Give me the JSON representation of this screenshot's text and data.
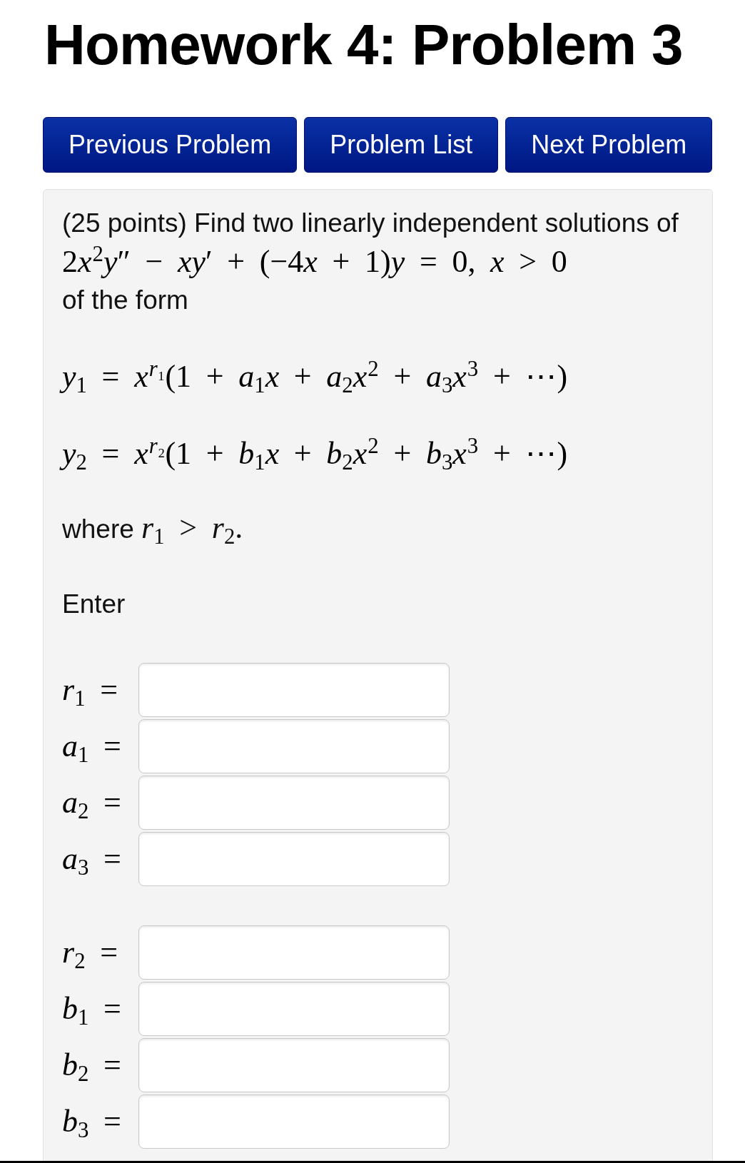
{
  "title": "Homework 4: Problem 3",
  "nav_buttons": [
    {
      "label": "Previous Problem"
    },
    {
      "label": "Problem List"
    },
    {
      "label": "Next Problem"
    }
  ],
  "problem": {
    "intro": "(25 points) Find two linearly independent solutions of",
    "equation": "2x$^{2}$y″ − xy′ + (−4x + 1)y = 0, x > 0",
    "form_text": "of the form",
    "solutions": [
      "y$_{1}$ = x$^{r₁}$(1 + a$_{1}$x + a$_{2}$x$^{2}$ + a$_{3}$x$^{3}$ + ⋯)",
      "y$_{2}$ = x$^{r₂}$(1 + b$_{1}$x + b$_{2}$x$^{2}$ + b$_{3}$x$^{3}$ + ⋯)"
    ],
    "condition": {
      "text": "where",
      "math": "r$_{1}$ > r$_{2}$."
    },
    "prompt": "Enter",
    "answer_groups": [
      {
        "fields": [
          {
            "label": "r$_{1}$ ="
          },
          {
            "label": "a$_{1}$ ="
          },
          {
            "label": "a$_{2}$ ="
          },
          {
            "label": "a$_{3}$ ="
          }
        ]
      },
      {
        "fields": [
          {
            "label": "r$_{2}$ ="
          },
          {
            "label": "b$_{1}$ ="
          },
          {
            "label": "b$_{2}$ ="
          },
          {
            "label": "b$_{3}$ ="
          }
        ]
      }
    ]
  }
}
